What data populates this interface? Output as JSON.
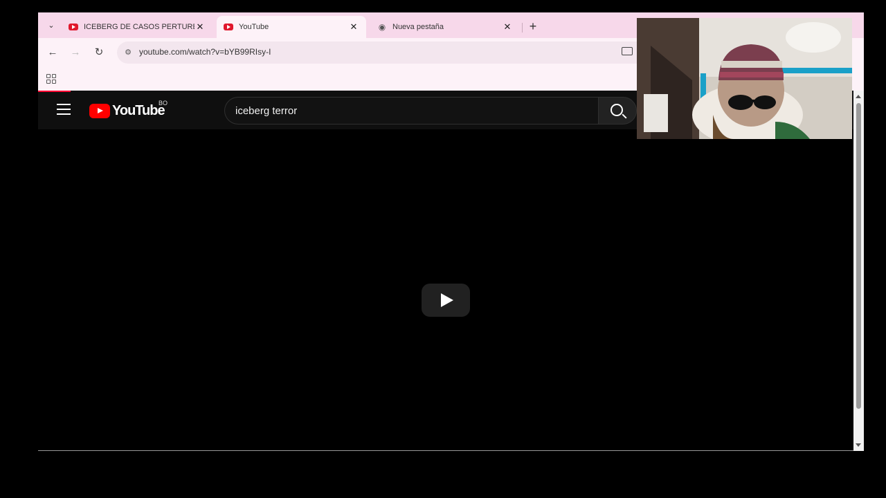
{
  "browser": {
    "tabs": [
      {
        "title": "ICEBERG DE CASOS PERTURBADORES",
        "icon": "youtube-icon",
        "active": false
      },
      {
        "title": "YouTube",
        "icon": "youtube-icon",
        "active": true
      },
      {
        "title": "Nueva pestaña",
        "icon": "incognito-icon",
        "active": false
      }
    ],
    "url": "youtube.com/watch?v=bYB99RIsy-I"
  },
  "youtube": {
    "logo_text": "YouTube",
    "country_code": "BO",
    "search_value": "iceberg terror"
  },
  "colors": {
    "tabstrip": "#f7d8ea",
    "toolbar": "#fdf2f8",
    "youtube_red": "#ff0000",
    "page_bg": "#0f0f0f"
  }
}
